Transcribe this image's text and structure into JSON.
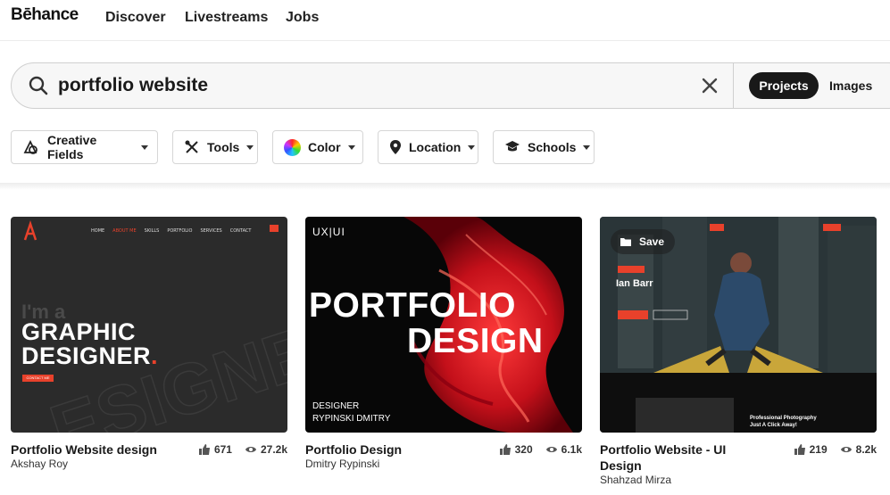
{
  "nav": {
    "logo": "Bēhance",
    "links": [
      "Discover",
      "Livestreams",
      "Jobs"
    ]
  },
  "search": {
    "query": "portfolio website",
    "tabs": {
      "active": "Projects",
      "other": "Images"
    }
  },
  "filters": [
    {
      "label": "Creative Fields",
      "icon": "creative-fields-icon"
    },
    {
      "label": "Tools",
      "icon": "tools-icon"
    },
    {
      "label": "Color",
      "icon": "color-wheel-icon"
    },
    {
      "label": "Location",
      "icon": "location-pin-icon"
    },
    {
      "label": "Schools",
      "icon": "graduation-cap-icon"
    }
  ],
  "projects": [
    {
      "title": "Portfolio Website design",
      "owner": "Akshay Roy",
      "likes": "671",
      "views": "27.2k",
      "thumb": {
        "nav": [
          "HOME",
          "ABOUT ME",
          "SKILLS",
          "PORTFOLIO",
          "SERVICES",
          "CONTACT"
        ],
        "intro": "I'm a",
        "headline1": "GRAPHIC",
        "headline2": "DESIGNER",
        "cta": "CONTACT ME",
        "accent": "#e8412b"
      }
    },
    {
      "title": "Portfolio Design",
      "owner": "Dmitry Rypinski",
      "likes": "320",
      "views": "6.1k",
      "thumb": {
        "tag": "UX|UI",
        "line1": "PORTFOLIO",
        "line2": "DESIGN",
        "credit1": "DESIGNER",
        "credit2": "RYPINSKI DMITRY"
      }
    },
    {
      "title": "Portfolio Website - UI Design",
      "owner": "Shahzad Mirza",
      "likes": "219",
      "views": "8.2k",
      "thumb": {
        "save": "Save",
        "name": "Ian Barr",
        "promo1": "Professional Photography",
        "promo2": "Just A Click Away!"
      }
    }
  ],
  "colors": {
    "text": "#191919",
    "accent_red": "#e8412b",
    "pill_active": "#191919"
  }
}
